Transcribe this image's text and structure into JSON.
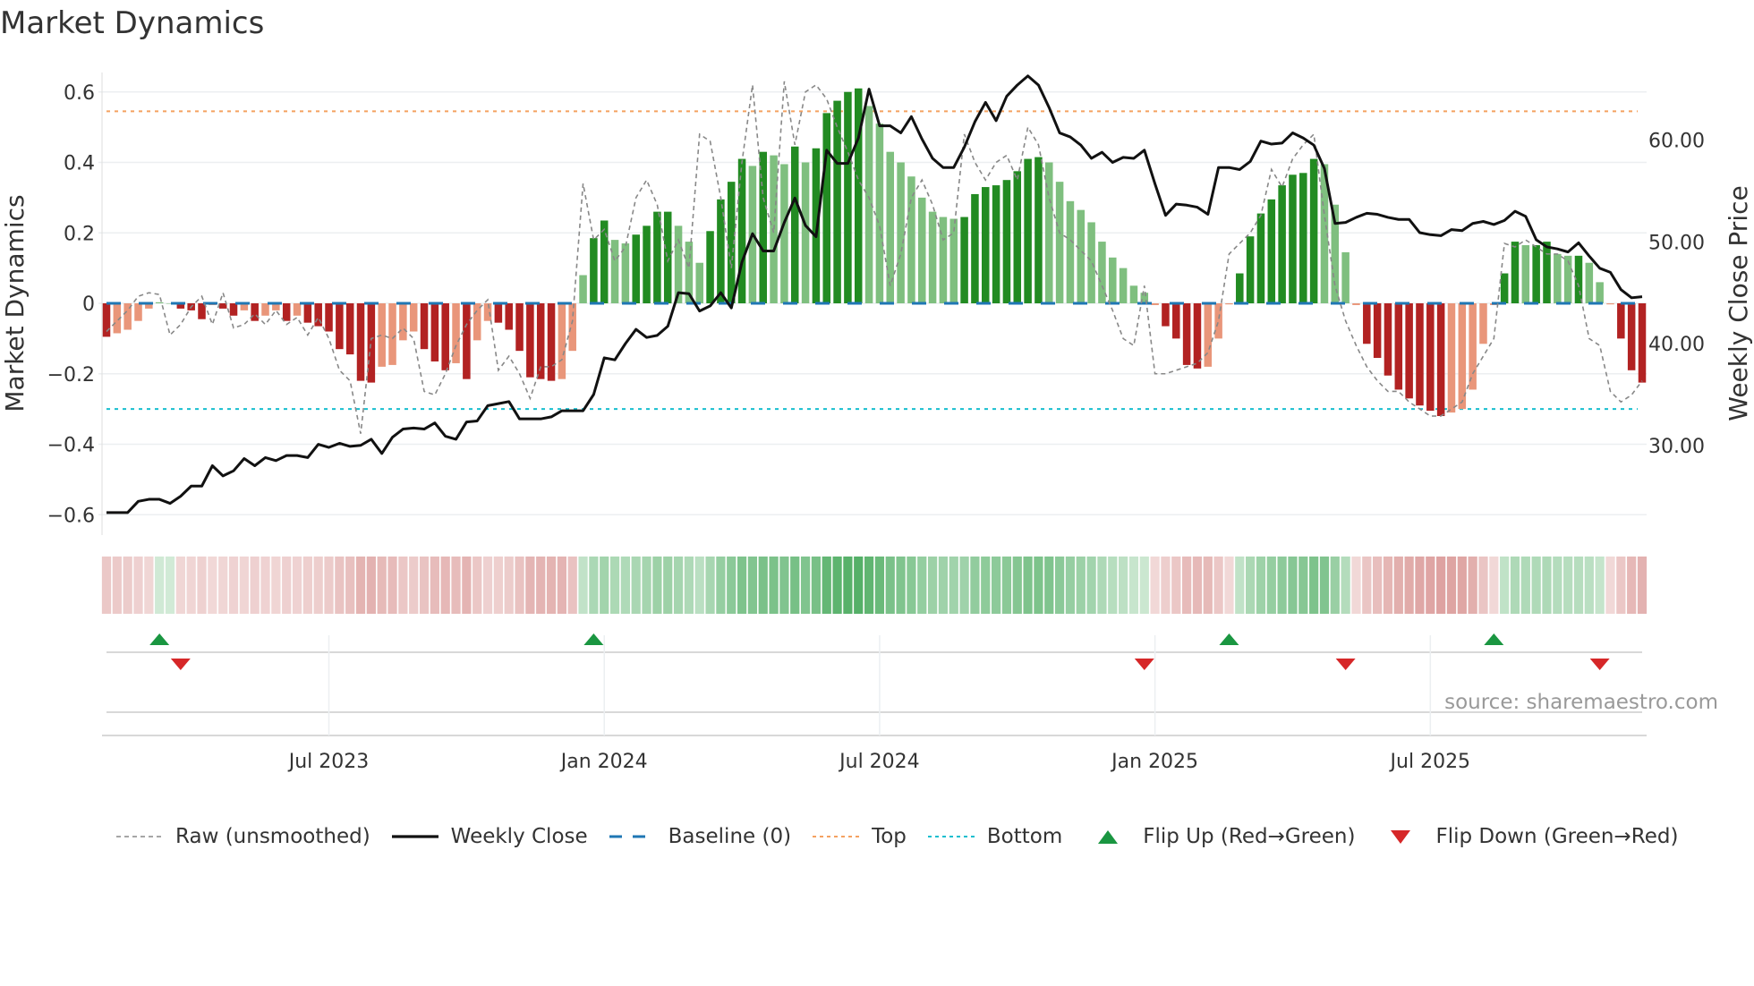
{
  "title": "Market Dynamics",
  "source": "source: sharemaestro.com",
  "chart_data": {
    "type": "bar",
    "title": "Market Dynamics",
    "ylabel": "Market Dynamics",
    "y2label": "Weekly Close Price",
    "ylim": [
      -0.65,
      0.65
    ],
    "y2lim": [
      19.5,
      70.7
    ],
    "yticks": [
      {
        "v": 0.6,
        "label": "0.6"
      },
      {
        "v": 0.4,
        "label": "0.4"
      },
      {
        "v": 0.2,
        "label": "0.2"
      },
      {
        "v": 0,
        "label": "0"
      },
      {
        "v": -0.2,
        "label": "−0.2"
      },
      {
        "v": -0.4,
        "label": "−0.4"
      },
      {
        "v": -0.6,
        "label": "−0.6"
      }
    ],
    "y2ticks": [
      {
        "v": 60,
        "label": "60.00"
      },
      {
        "v": 50,
        "label": "50.00"
      },
      {
        "v": 40,
        "label": "40.00"
      },
      {
        "v": 30,
        "label": "30.00"
      }
    ],
    "xticks": [
      {
        "week": 21,
        "label": "Jul 2023"
      },
      {
        "week": 47,
        "label": "Jan 2024"
      },
      {
        "week": 73,
        "label": "Jul 2024"
      },
      {
        "week": 99,
        "label": "Jan 2025"
      },
      {
        "week": 125,
        "label": "Jul 2025"
      }
    ],
    "top_level": 0.545,
    "bottom_level": -0.3,
    "baseline": 0,
    "values": [
      -0.095,
      -0.085,
      -0.075,
      -0.05,
      -0.015,
      0.003,
      0,
      -0.015,
      -0.02,
      -0.045,
      -0.005,
      -0.015,
      -0.035,
      -0.02,
      -0.05,
      -0.035,
      -0.02,
      -0.05,
      -0.035,
      -0.055,
      -0.065,
      -0.08,
      -0.13,
      -0.145,
      -0.22,
      -0.225,
      -0.18,
      -0.175,
      -0.105,
      -0.08,
      -0.13,
      -0.165,
      -0.19,
      -0.17,
      -0.215,
      -0.105,
      -0.05,
      -0.055,
      -0.075,
      -0.135,
      -0.21,
      -0.215,
      -0.22,
      -0.215,
      -0.135,
      0.08,
      0.185,
      0.235,
      0.18,
      0.17,
      0.195,
      0.22,
      0.26,
      0.26,
      0.22,
      0.175,
      0.115,
      0.205,
      0.295,
      0.345,
      0.41,
      0.39,
      0.43,
      0.42,
      0.395,
      0.445,
      0.4,
      0.44,
      0.54,
      0.575,
      0.6,
      0.61,
      0.56,
      0.51,
      0.43,
      0.4,
      0.36,
      0.3,
      0.26,
      0.245,
      0.24,
      0.245,
      0.31,
      0.33,
      0.335,
      0.35,
      0.375,
      0.41,
      0.415,
      0.4,
      0.345,
      0.29,
      0.265,
      0.23,
      0.175,
      0.13,
      0.1,
      0.05,
      0.03,
      -0.005,
      -0.065,
      -0.1,
      -0.175,
      -0.185,
      -0.18,
      -0.1,
      -0.003,
      0.085,
      0.19,
      0.255,
      0.295,
      0.335,
      0.365,
      0.37,
      0.41,
      0.395,
      0.28,
      0.145,
      -0.005,
      -0.115,
      -0.155,
      -0.205,
      -0.245,
      -0.27,
      -0.29,
      -0.305,
      -0.32,
      -0.31,
      -0.3,
      -0.245,
      -0.115,
      -0.005,
      0.085,
      0.175,
      0.165,
      0.165,
      0.175,
      0.14,
      0.135,
      0.135,
      0.115,
      0.06,
      -0.003,
      -0.1,
      -0.19,
      -0.225
    ],
    "raw": [
      -0.08,
      -0.05,
      -0.02,
      0.02,
      0.03,
      0.025,
      -0.09,
      -0.06,
      -0.01,
      0.02,
      -0.06,
      0.03,
      -0.07,
      -0.06,
      -0.03,
      -0.06,
      -0.02,
      -0.06,
      -0.04,
      -0.09,
      -0.04,
      -0.1,
      -0.19,
      -0.22,
      -0.37,
      -0.1,
      -0.09,
      -0.1,
      -0.07,
      -0.1,
      -0.25,
      -0.26,
      -0.2,
      -0.12,
      -0.06,
      -0.02,
      0.01,
      -0.19,
      -0.15,
      -0.2,
      -0.27,
      -0.18,
      -0.18,
      -0.16,
      -0.05,
      0.34,
      0.18,
      0.21,
      0.12,
      0.16,
      0.3,
      0.35,
      0.28,
      0.12,
      0.18,
      0.1,
      0.48,
      0.46,
      0.3,
      0.1,
      0.4,
      0.62,
      0.3,
      0.2,
      0.63,
      0.45,
      0.6,
      0.62,
      0.58,
      0.5,
      0.43,
      0.35,
      0.3,
      0.22,
      0.05,
      0.14,
      0.3,
      0.35,
      0.28,
      0.18,
      0.2,
      0.48,
      0.4,
      0.35,
      0.4,
      0.42,
      0.35,
      0.5,
      0.45,
      0.3,
      0.2,
      0.18,
      0.15,
      0.12,
      0.05,
      -0.02,
      -0.1,
      -0.12,
      0.05,
      -0.2,
      -0.2,
      -0.19,
      -0.18,
      -0.17,
      -0.14,
      -0.05,
      0.14,
      0.17,
      0.2,
      0.25,
      0.38,
      0.33,
      0.41,
      0.45,
      0.48,
      0.25,
      0.05,
      -0.05,
      -0.12,
      -0.18,
      -0.22,
      -0.25,
      -0.25,
      -0.28,
      -0.3,
      -0.32,
      -0.32,
      -0.3,
      -0.28,
      -0.2,
      -0.15,
      -0.1,
      0.17,
      0.16,
      0.18,
      0.16,
      0.14,
      0.14,
      0.12,
      0.05,
      -0.1,
      -0.12,
      -0.25,
      -0.28,
      -0.26,
      -0.22
    ],
    "close": [
      23.4,
      23.4,
      23.4,
      24.5,
      24.7,
      24.7,
      24.3,
      25,
      26,
      26,
      28,
      27,
      27.5,
      28.7,
      28,
      28.8,
      28.5,
      29,
      29,
      28.8,
      30.1,
      29.8,
      30.2,
      29.9,
      30,
      30.6,
      29.2,
      30.8,
      31.6,
      31.7,
      31.6,
      32.2,
      30.9,
      30.6,
      32.3,
      32.4,
      33.9,
      34.1,
      34.3,
      32.6,
      32.6,
      32.6,
      32.8,
      33.4,
      33.4,
      33.4,
      35,
      38.6,
      38.4,
      40,
      41.4,
      40.6,
      40.8,
      41.7,
      45,
      44.9,
      43.2,
      43.7,
      45,
      43.5,
      48,
      50.8,
      49.1,
      49.1,
      51.9,
      54.3,
      51.6,
      50.5,
      59,
      57.7,
      57.7,
      60.2,
      65,
      61.4,
      61.4,
      60.7,
      62.3,
      60.1,
      58.2,
      57.3,
      57.3,
      59.3,
      61.8,
      63.7,
      61.9,
      64.3,
      65.4,
      66.3,
      65.4,
      63.2,
      60.7,
      60.3,
      59.5,
      58.2,
      58.8,
      57.8,
      58.3,
      58.2,
      59,
      55.7,
      52.6,
      53.7,
      53.6,
      53.4,
      52.7,
      57.3,
      57.3,
      57.1,
      57.9,
      59.9,
      59.6,
      59.7,
      60.7,
      60.2,
      59.5,
      57.2,
      51.8,
      51.9,
      52.4,
      52.8,
      52.7,
      52.4,
      52.2,
      52.2,
      50.9,
      50.7,
      50.6,
      51.2,
      51.1,
      51.8,
      52,
      51.7,
      52.1,
      53,
      52.5,
      50.2,
      49.5,
      49.3,
      49,
      49.9,
      48.6,
      47.4,
      47,
      45.3,
      44.5,
      44.6
    ],
    "flip_up_weeks": [
      5,
      46,
      106,
      131
    ],
    "flip_down_weeks": [
      7,
      98,
      117,
      141
    ],
    "colors": {
      "pos_strong": "#228b22",
      "pos_weak": "#7fbf7f",
      "neg_strong": "#b22222",
      "neg_weak": "#e9967a",
      "raw": "#888888",
      "close": "#111111",
      "baseline": "#1f77b4",
      "top": "#f4a261",
      "bottom": "#17becf",
      "flip_up": "#1a9641",
      "flip_down": "#d62728"
    },
    "legend": [
      {
        "key": "raw",
        "label": "Raw (unsmoothed)"
      },
      {
        "key": "close",
        "label": "Weekly Close"
      },
      {
        "key": "baseline",
        "label": "Baseline (0)"
      },
      {
        "key": "top",
        "label": "Top"
      },
      {
        "key": "bottom",
        "label": "Bottom"
      },
      {
        "key": "flip_up",
        "label": "Flip Up (Red→Green)"
      },
      {
        "key": "flip_down",
        "label": "Flip Down (Green→Red)"
      }
    ],
    "legend_position": "bottom"
  }
}
